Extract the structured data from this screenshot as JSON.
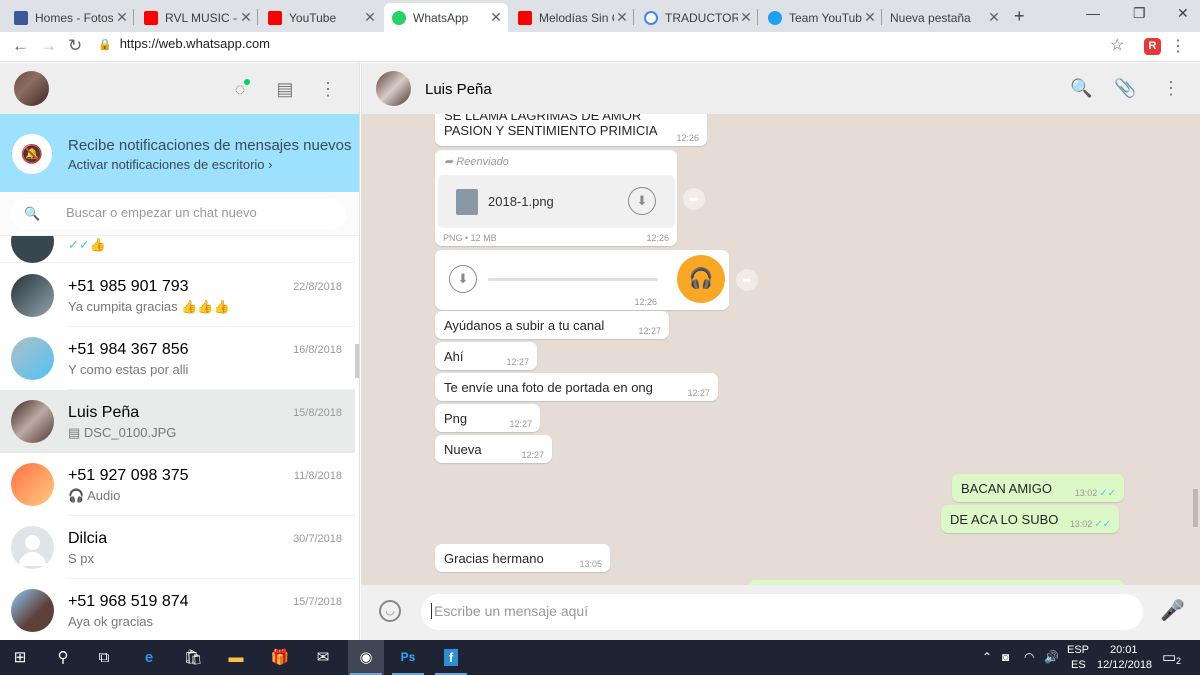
{
  "browser": {
    "tabs": [
      {
        "title": "Homes - Fotos",
        "favicon": "facebook-icon",
        "color": "#3b5998"
      },
      {
        "title": "RVL MUSIC - Y",
        "favicon": "youtube-icon",
        "color": "#ff0000"
      },
      {
        "title": "YouTube",
        "favicon": "youtube-icon",
        "color": "#ff0000"
      },
      {
        "title": "WhatsApp",
        "favicon": "whatsapp-icon",
        "color": "#25d366"
      },
      {
        "title": "Melodías Sin C",
        "favicon": "youtube-icon",
        "color": "#ff0000"
      },
      {
        "title": "TRADUCTOR -",
        "favicon": "google-icon",
        "color": "#4285f4"
      },
      {
        "title": "Team YouTube",
        "favicon": "twitter-icon",
        "color": "#1da1f2"
      },
      {
        "title": "Nueva pestaña",
        "favicon": "",
        "color": ""
      }
    ],
    "url": "https://web.whatsapp.com",
    "extension_label": "R"
  },
  "sidebar": {
    "notification": {
      "title": "Recibe notificaciones de mensajes nuevos",
      "link": "Activar notificaciones de escritorio ›"
    },
    "search_placeholder": "Buscar o empezar un chat nuevo",
    "partial_chat_msg": "✓✓👍",
    "chats": [
      {
        "name": "+51 985 901 793",
        "date": "22/8/2018",
        "msg": "Ya cumpita gracias 👍👍👍",
        "avatar": "#263238"
      },
      {
        "name": "+51 984 367 856",
        "date": "16/8/2018",
        "msg": "Y como estas por alli",
        "avatar": "#90a4ae"
      },
      {
        "name": "Luis Peña",
        "date": "15/8/2018",
        "msg": "▤ DSC_0100.JPG",
        "avatar": "#4e342e"
      },
      {
        "name": "+51 927 098 375",
        "date": "11/8/2018",
        "msg": "🎧 Audio",
        "avatar": "#ff8a65"
      },
      {
        "name": "Dilcia",
        "date": "30/7/2018",
        "msg": "S px",
        "avatar": "#e0e0e0"
      },
      {
        "name": "+51 968 519 874",
        "date": "15/7/2018",
        "msg": "Aya ok gracias",
        "avatar": "#5d4037"
      }
    ]
  },
  "conversation": {
    "contact_name": "Luis Peña",
    "messages": {
      "m1_text": "SE LLAMA LAGRIMAS DE AMOR\nPASION Y SENTIMIENTO PRIMICIA",
      "m1_time": "12:26",
      "m2_forwarded": "Reenviado",
      "m2_filename": "2018-1.png",
      "m2_meta": "PNG • 12 MB",
      "m2_time": "12:26",
      "m3_time": "12:26",
      "m4_text": "Ayúdanos a subir a tu canal",
      "m4_time": "12:27",
      "m5_text": "Ahí",
      "m5_time": "12:27",
      "m6_text": "Te envíe una foto de portada en ong",
      "m6_time": "12:27",
      "m7_text": "Png",
      "m7_time": "12:27",
      "m8_text": "Nueva",
      "m8_time": "12:27",
      "m9_text": "BACAN AMIGO",
      "m9_time": "13:02",
      "m10_text": "DE ACA LO SUBO",
      "m10_time": "13:02",
      "m11_text": "Gracias hermano",
      "m11_time": "13:05"
    },
    "composer_placeholder": "Escribe un mensaje aquí"
  },
  "taskbar": {
    "lang": "ESP",
    "lang2": "ES",
    "time": "20:01",
    "date": "12/12/2018",
    "notif_count": "2"
  }
}
